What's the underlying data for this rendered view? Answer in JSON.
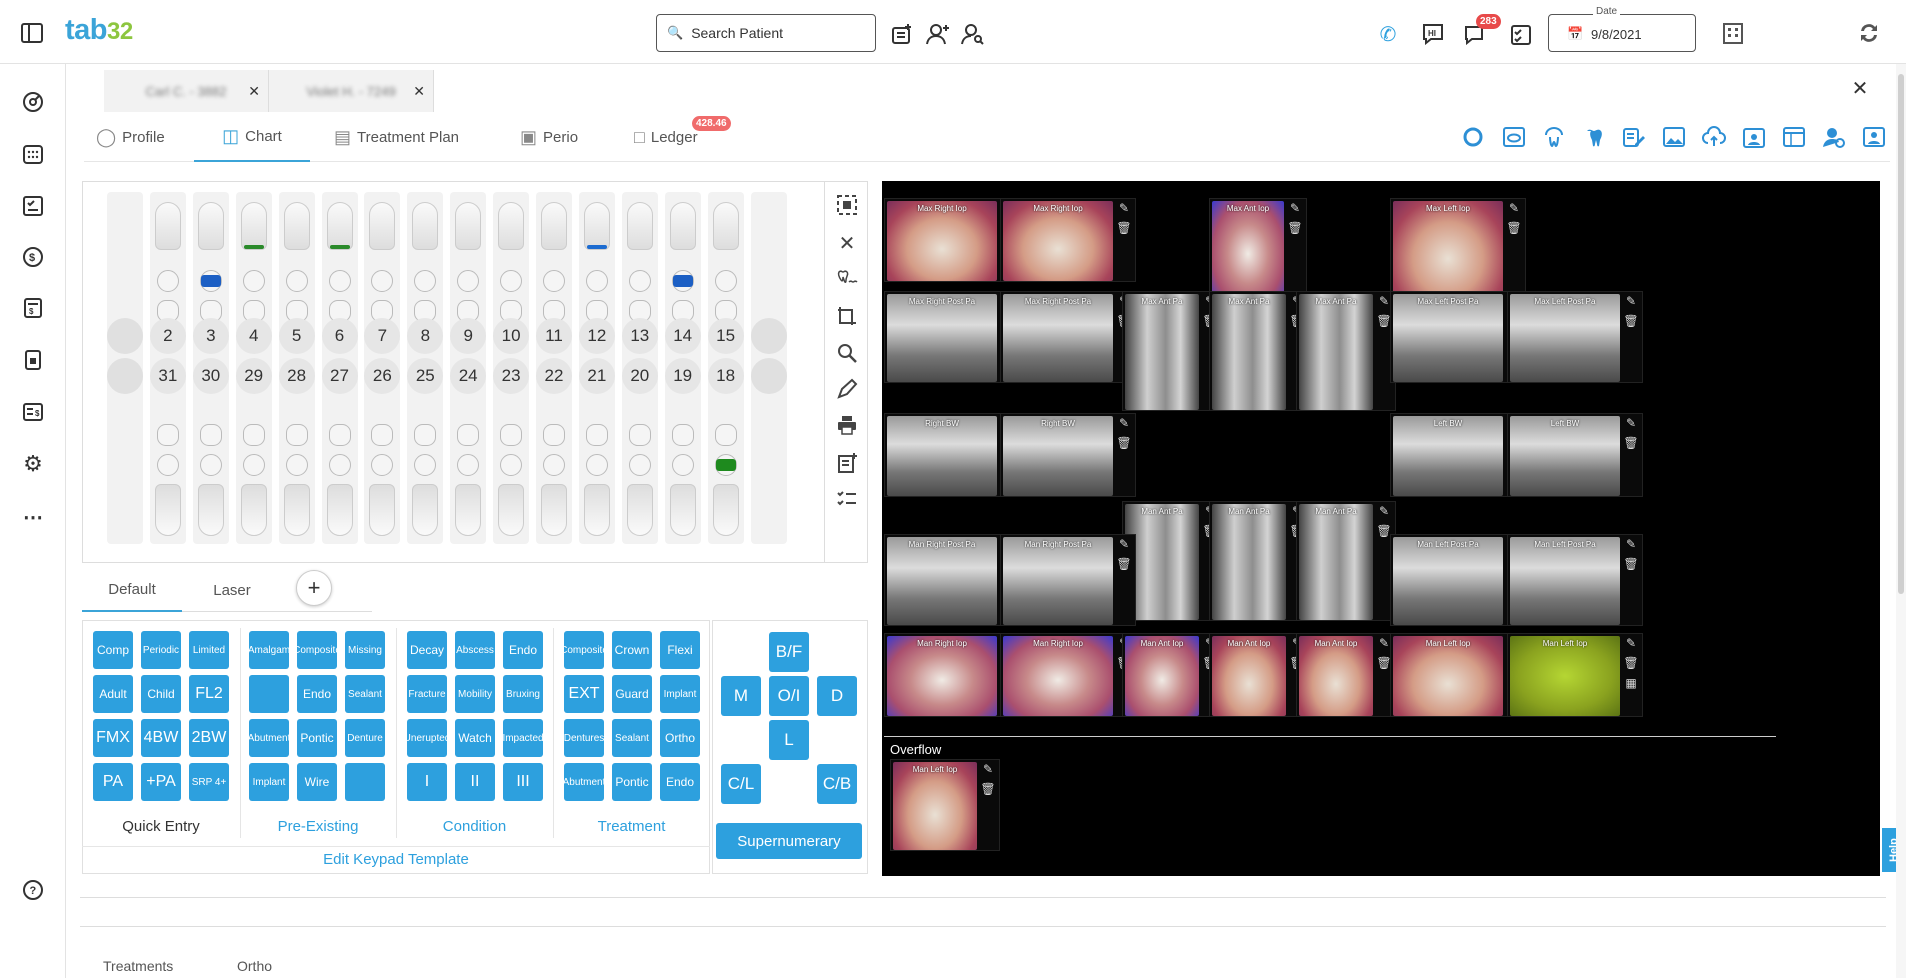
{
  "app": {
    "logo_text": "tab",
    "logo_num": "32"
  },
  "topbar": {
    "search_placeholder": "Search Patient",
    "date_label": "Date",
    "date_value": "9/8/2021",
    "messages_badge": "283",
    "icons": [
      "sidebar-toggle-icon",
      "add-note-icon",
      "add-patient-icon",
      "find-patient-icon",
      "phone-icon",
      "chat-hi-icon",
      "messages-icon",
      "tasks-icon",
      "calendar-icon",
      "building-icon",
      "sync-icon"
    ]
  },
  "sidebar": {
    "icons": [
      "dashboard-icon",
      "schedule-icon",
      "checklist-icon",
      "billing-icon",
      "calculator-icon",
      "documents-icon",
      "ledger-icon",
      "settings-icon",
      "more-icon",
      "help-icon"
    ]
  },
  "patient_tabs": [
    {
      "label": "Carl C. - 3882"
    },
    {
      "label": "Violet H. - 7249"
    }
  ],
  "nav_tabs": [
    {
      "label": "Profile",
      "icon": "profile-icon"
    },
    {
      "label": "Chart",
      "icon": "chart-icon"
    },
    {
      "label": "Treatment Plan",
      "icon": "treatment-plan-icon"
    },
    {
      "label": "Perio",
      "icon": "perio-icon"
    },
    {
      "label": "Ledger",
      "icon": "ledger-icon",
      "badge": "428.46"
    }
  ],
  "accent": "#2da0de",
  "teeth_upper": [
    "2",
    "3",
    "4",
    "5",
    "6",
    "7",
    "8",
    "9",
    "10",
    "11",
    "12",
    "13",
    "14",
    "15"
  ],
  "teeth_lower": [
    "31",
    "30",
    "29",
    "28",
    "27",
    "26",
    "25",
    "24",
    "23",
    "22",
    "21",
    "20",
    "19",
    "18"
  ],
  "keypad_tabs": [
    "Default",
    "Laser"
  ],
  "keypad": {
    "quick_entry": [
      "Comp",
      "Periodic",
      "Limited",
      "Adult",
      "Child",
      "FL2",
      "FMX",
      "4BW",
      "2BW",
      "PA",
      "+PA",
      "SRP 4+"
    ],
    "pre_existing": [
      "Amalgam",
      "Composite",
      "Missing",
      "",
      "Endo",
      "Sealant",
      "Abutment",
      "Pontic",
      "Denture",
      "Implant",
      "Wire",
      ""
    ],
    "condition": [
      "Decay",
      "Abscess",
      "Endo",
      "Fracture",
      "Mobility",
      "Bruxing",
      "Unerupted",
      "Watch",
      "Impacted",
      "I",
      "II",
      "III"
    ],
    "treatment": [
      "Composite",
      "Crown",
      "Flexi",
      "EXT",
      "Guard",
      "Implant",
      "Dentures",
      "Sealant",
      "Ortho",
      "Abutment",
      "Pontic",
      "Endo"
    ],
    "labels": {
      "quick_entry": "Quick Entry",
      "pre_existing": "Pre-Existing",
      "condition": "Condition",
      "treatment": "Treatment"
    },
    "edit_template": "Edit Keypad Template"
  },
  "surfaces": {
    "bf": "B/F",
    "m": "M",
    "oi": "O/I",
    "d": "D",
    "l": "L",
    "cl": "C/L",
    "cb": "C/B",
    "supernumerary": "Supernumerary"
  },
  "xray_labels": {
    "r1": [
      "Max Right Iop",
      "Max Right Iop",
      "Max Ant Iop",
      "Max Left Iop"
    ],
    "r2": [
      "Max Right Post Pa",
      "Max Right Post Pa",
      "Max Ant Pa",
      "Max Ant Pa",
      "Max Ant Pa",
      "Max Left Post Pa",
      "Max Left Post Pa"
    ],
    "r3": [
      "Right BW",
      "Right BW",
      "Left BW",
      "Left BW"
    ],
    "r4a": [
      "Man Ant Pa",
      "Man Ant Pa",
      "Man Ant Pa"
    ],
    "r4": [
      "Man Right Post Pa",
      "Man Right Post Pa",
      "Man Left Post Pa",
      "Man Left Post Pa"
    ],
    "r5": [
      "Man Right Iop",
      "Man Right Iop",
      "Man Ant Iop",
      "Man Ant Iop",
      "Man Ant Iop",
      "Man Left Iop",
      "Man Left Iop"
    ],
    "overflow": "Overflow",
    "overflow_item": "Man Left Iop"
  },
  "bottom_tabs": [
    "Treatments",
    "Ortho"
  ],
  "help": "Help"
}
